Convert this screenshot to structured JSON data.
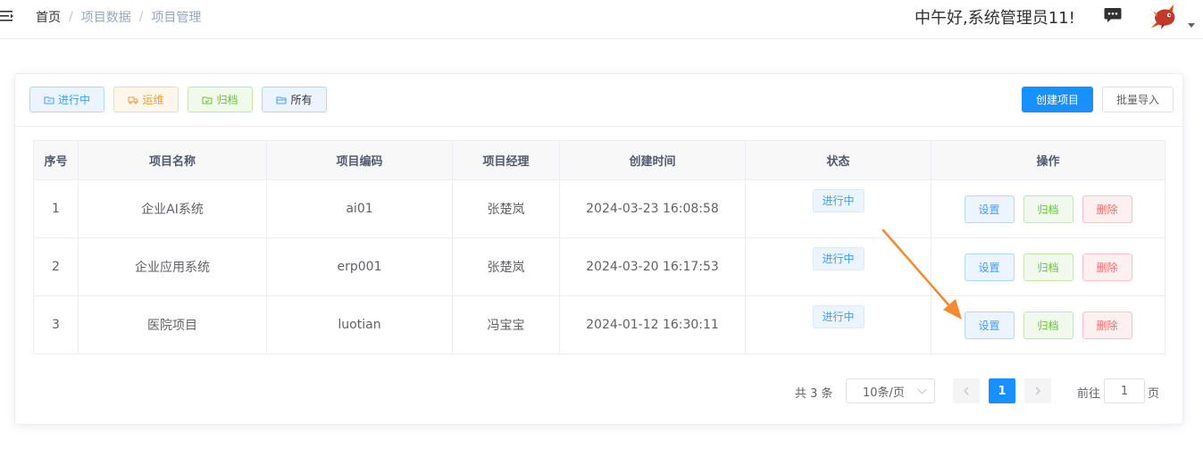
{
  "header": {
    "breadcrumb": [
      "首页",
      "项目数据",
      "项目管理"
    ],
    "breadcrumb_sep": "/",
    "greeting": "中午好,系统管理员11!",
    "icons": {
      "menu": "hamburger-icon",
      "chat": "chat-icon",
      "avatar": "fish-avatar"
    }
  },
  "filters": [
    {
      "label": "进行中",
      "icon": "folder-icon"
    },
    {
      "label": "运维",
      "icon": "truck-icon"
    },
    {
      "label": "归档",
      "icon": "archive-folder-icon"
    },
    {
      "label": "所有",
      "icon": "folder-open-icon"
    }
  ],
  "actions": {
    "create": "创建项目",
    "import": "批量导入"
  },
  "table": {
    "columns": [
      "序号",
      "项目名称",
      "项目编码",
      "项目经理",
      "创建时间",
      "状态",
      "操作"
    ],
    "rows": [
      {
        "index": "1",
        "name": "企业AI系统",
        "code": "ai01",
        "manager": "张楚岚",
        "created": "2024-03-23 16:08:58",
        "status": "进行中"
      },
      {
        "index": "2",
        "name": "企业应用系统",
        "code": "erp001",
        "manager": "张楚岚",
        "created": "2024-03-20 16:17:53",
        "status": "进行中"
      },
      {
        "index": "3",
        "name": "医院项目",
        "code": "luotian",
        "manager": "冯宝宝",
        "created": "2024-01-12 16:30:11",
        "status": "进行中"
      }
    ],
    "row_actions": {
      "settings": "设置",
      "archive": "归档",
      "delete": "删除"
    }
  },
  "pagination": {
    "total": "共 3 条",
    "page_size": "10条/页",
    "current_page": "1",
    "goto_label": "前往",
    "goto_value": "1",
    "goto_unit": "页"
  },
  "colors": {
    "primary": "#1890ff",
    "success": "#67c23a",
    "warning": "#e6a23c",
    "danger": "#f56c6c",
    "annotation_arrow": "#f5892f"
  }
}
